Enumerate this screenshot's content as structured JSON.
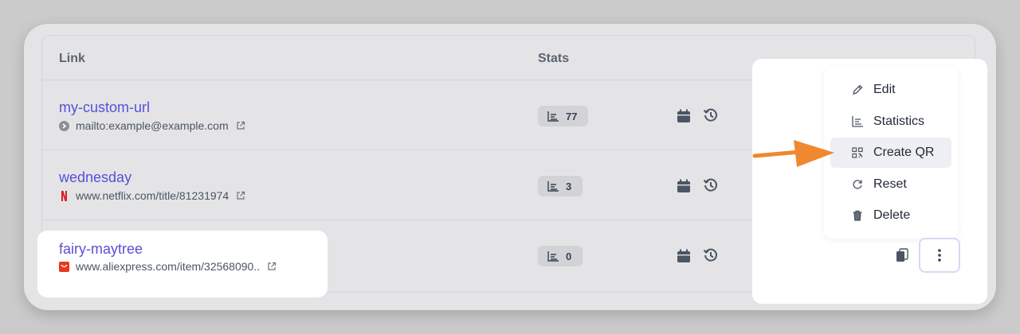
{
  "table": {
    "header": {
      "link": "Link",
      "stats": "Stats"
    },
    "rows": [
      {
        "slug": "my-custom-url",
        "url": "mailto:example@example.com",
        "clicks": "77",
        "favicon": "mail-icon"
      },
      {
        "slug": "wednesday",
        "url": "www.netflix.com/title/81231974",
        "clicks": "3",
        "favicon": "netflix-icon"
      },
      {
        "slug": "fairy-maytree",
        "url": "www.aliexpress.com/item/32568090..",
        "clicks": "0",
        "favicon": "aliexpress-icon"
      }
    ]
  },
  "menu": {
    "items": [
      {
        "label": "Edit",
        "icon": "pencil-icon"
      },
      {
        "label": "Statistics",
        "icon": "chart-icon"
      },
      {
        "label": "Create QR",
        "icon": "qr-icon",
        "active": true
      },
      {
        "label": "Reset",
        "icon": "reset-icon"
      },
      {
        "label": "Delete",
        "icon": "trash-icon"
      }
    ]
  },
  "colors": {
    "link": "#5750d6",
    "arrow": "#f0882f",
    "card_bg": "#e4e4e6",
    "highlight": "#ffffff"
  }
}
